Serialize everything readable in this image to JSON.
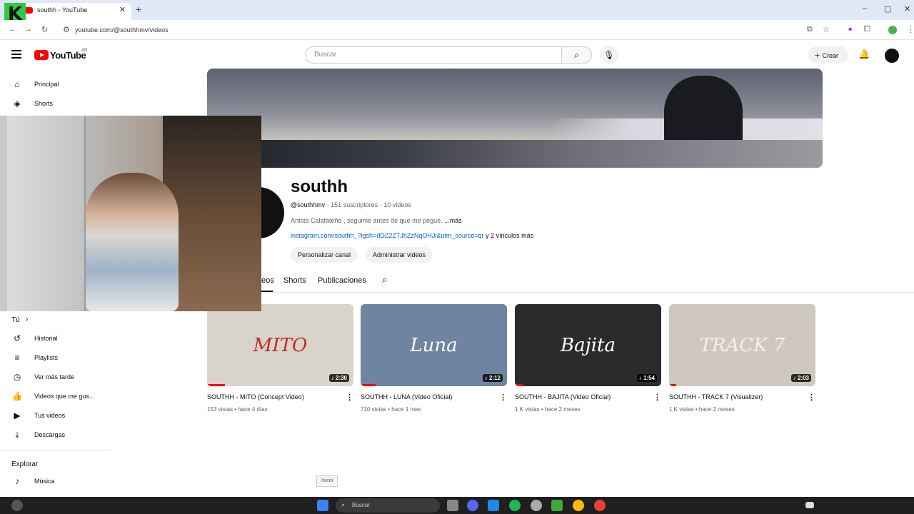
{
  "browser": {
    "tab_title": "southh - YouTube",
    "tab_close": "✕",
    "new_tab": "+",
    "url": "youtube.com/@southhmv/videos",
    "logo_letter": "K"
  },
  "header": {
    "logo_text": "YouTube",
    "logo_region": "AR",
    "search_placeholder": "Buscar",
    "create_label": "Crear"
  },
  "sidebar": {
    "items": [
      {
        "label": "Principal",
        "icon": "home-icon"
      },
      {
        "label": "Shorts",
        "icon": "shorts-icon"
      },
      {
        "label": "Tú",
        "icon": "chevron-right-icon"
      },
      {
        "label": "Historial",
        "icon": "history-icon"
      },
      {
        "label": "Playlists",
        "icon": "playlist-icon"
      },
      {
        "label": "Ver más tarde",
        "icon": "clock-icon"
      },
      {
        "label": "Videos que me gus...",
        "icon": "thumbs-up-icon"
      },
      {
        "label": "Tus videos",
        "icon": "video-icon"
      },
      {
        "label": "Descargas",
        "icon": "download-icon"
      },
      {
        "label": "Explorar",
        "icon": ""
      },
      {
        "label": "Música",
        "icon": "music-icon"
      }
    ]
  },
  "channel": {
    "name": "southh",
    "handle": "@southhmv",
    "subscribers": "151 suscriptores",
    "videos_count": "10 videos",
    "description": "Artista Calafateño , seguime antes de que me pegue.",
    "more": "...más",
    "link": "instagram.com/southh_?igsh=dDZ2ZTJhZzNqOHJi&utm_source=qr",
    "more_links": "y 2 vínculos más",
    "btn_customize": "Personalizar canal",
    "btn_manage": "Administrar videos"
  },
  "tabs": [
    "eos",
    "Shorts",
    "Publicaciones"
  ],
  "videos": [
    {
      "title": "SOUTHH - MITO (Concept Video)",
      "meta": "153 vistas • hace 4 días",
      "duration": "♪ 2:30",
      "overlay": "MITO",
      "bg": "#d9d4c9",
      "overlay_color": "#c62828"
    },
    {
      "title": "SOUTHH - LUNA (Video Oficial)",
      "meta": "710 vistas • hace 1 mes",
      "duration": "♪ 2:12",
      "overlay": "Luna",
      "bg": "#6e84a0",
      "overlay_color": "#ffffff"
    },
    {
      "title": "SOUTHH - BAJITA (Video Oficial)",
      "meta": "1 K vistas • hace 2 meses",
      "duration": "♪ 1:54",
      "overlay": "Bajita",
      "bg": "#2b2b2e",
      "overlay_color": "#ffffff"
    },
    {
      "title": "SOUTHH - TRACK 7 (Visualizer)",
      "meta": "1 K vistas • hace 2 meses",
      "duration": "♪ 2:03",
      "overlay": "TRACK 7",
      "bg": "#cfc8bf",
      "overlay_color": "#f5f0ea"
    }
  ],
  "tooltip": "Inicio",
  "taskbar": {
    "search_label": "Buscar"
  }
}
